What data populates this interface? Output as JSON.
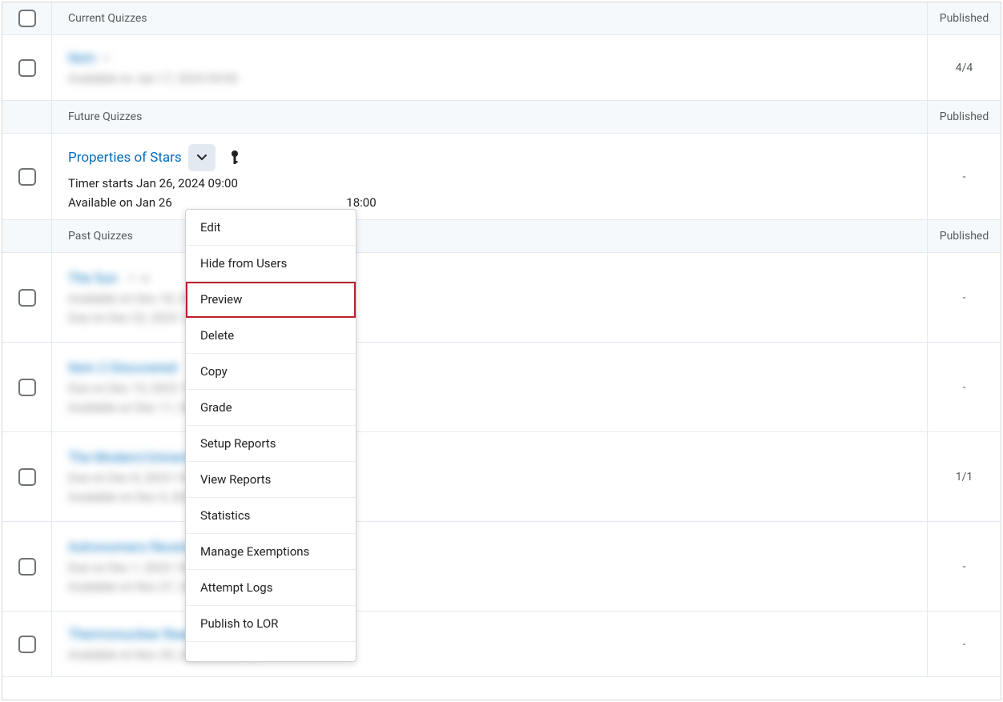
{
  "sections": {
    "current": {
      "header": "Current Quizzes",
      "published_header": "Published"
    },
    "future": {
      "header": "Future Quizzes",
      "published_header": "Published"
    },
    "past": {
      "header": "Past Quizzes",
      "published_header": "Published"
    }
  },
  "quizzes": {
    "current_1": {
      "title_blur": "Item",
      "meta1_blur": "Available on Jan 17, 2024 09:00",
      "published": "4/4"
    },
    "future_1": {
      "title": "Properties of Stars",
      "timer": "Timer starts Jan 26, 2024 09:00",
      "avail_prefix": "Available on Jan 26",
      "avail_suffix": "18:00",
      "published": "-"
    },
    "past_1": {
      "title_blur": "The Sun",
      "meta1_blur": "Available on Dec 18, 2023 09:00",
      "meta2_blur": "Due on Dec 22, 2023 18:00 PST",
      "published": "-"
    },
    "past_2": {
      "title_blur": "Item 2 Discovered",
      "meta1_blur": "Due on Dec 15, 2023 18:00 PST",
      "meta2_blur": "Available on Dec 11, 2023 09:00 PST",
      "published": "-"
    },
    "past_3": {
      "title_blur": "The Modern/Universe",
      "meta1_blur": "Due on Dec 8, 2023 18:00 PST",
      "meta2_blur": "Available on Dec 4, 2023 09:00",
      "published": "1/1"
    },
    "past_4": {
      "title_blur": "Astronomers Receiving",
      "meta1_blur": "Due on Dec 1, 2023 18:00 PST",
      "meta2_blur": "Available on Nov 27, 2023 09:00 PST",
      "published": "-"
    },
    "past_5": {
      "title_blur": "Thermonuclear Reactions Yield",
      "meta1_blur": "Available on Nov 20, 2023 09:00 PST",
      "published": "-"
    }
  },
  "menu": {
    "edit": "Edit",
    "hide": "Hide from Users",
    "preview": "Preview",
    "delete": "Delete",
    "copy": "Copy",
    "grade": "Grade",
    "setup_reports": "Setup Reports",
    "view_reports": "View Reports",
    "statistics": "Statistics",
    "manage_exemptions": "Manage Exemptions",
    "attempt_logs": "Attempt Logs",
    "publish_lor": "Publish to LOR"
  }
}
